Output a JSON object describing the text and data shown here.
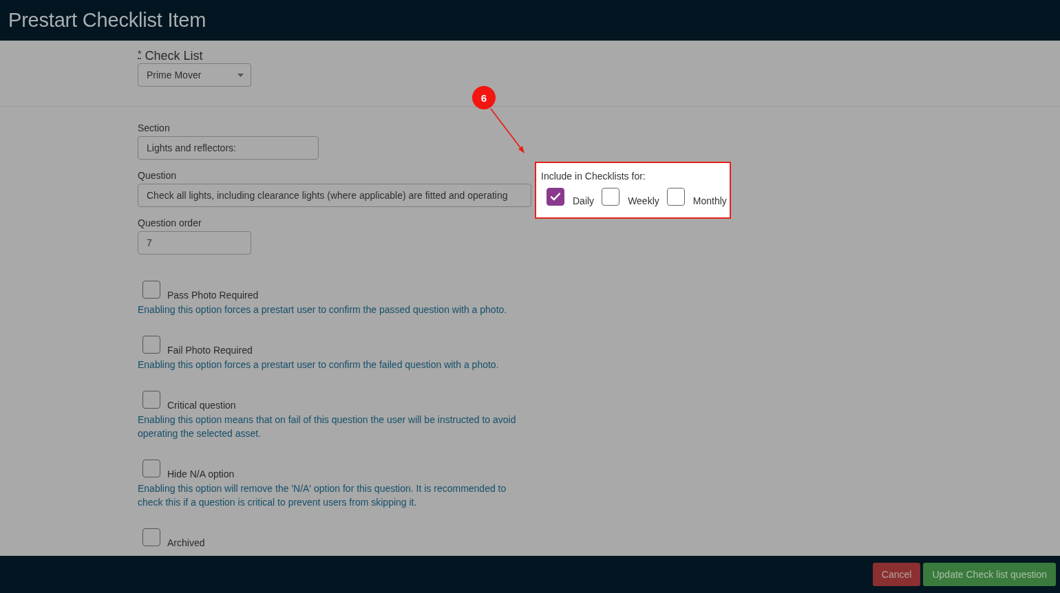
{
  "header": {
    "title": "Prestart Checklist Item"
  },
  "check_list": {
    "required_mark": "*",
    "label": "Check List",
    "value": "Prime Mover"
  },
  "fields": [
    {
      "label": "Section",
      "value": "Lights and reflectors:",
      "kind": "short"
    },
    {
      "label": "Question",
      "value": "Check all lights, including clearance lights (where applicable) are fitted and operating",
      "kind": "long"
    },
    {
      "label": "Question order",
      "value": "7",
      "kind": "small"
    }
  ],
  "options": [
    {
      "label": "Pass Photo Required",
      "checked": false,
      "help": "Enabling this option forces a prestart user to confirm the passed question with a photo."
    },
    {
      "label": "Fail Photo Required",
      "checked": false,
      "help": "Enabling this option forces a prestart user to confirm the failed question with a photo."
    },
    {
      "label": "Critical question",
      "checked": false,
      "help": "Enabling this option means that on fail of this question the user will be instructed to avoid operating the selected asset."
    },
    {
      "label": "Hide N/A option",
      "checked": false,
      "help": "Enabling this option will remove the 'N/A' option for this question. It is recommended to check this if a question is critical to prevent users from skipping it."
    },
    {
      "label": "Archived",
      "checked": false
    }
  ],
  "tour": {
    "step": "6",
    "label": "Include in Checklists for:",
    "frequencies": [
      {
        "label": "Daily",
        "checked": true
      },
      {
        "label": "Weekly",
        "checked": false
      },
      {
        "label": "Monthly",
        "checked": false
      }
    ]
  },
  "footer": {
    "buttons": [
      {
        "label": "Cancel",
        "kind": "cancel"
      },
      {
        "label": "Update Check list question",
        "kind": "primary"
      }
    ]
  }
}
